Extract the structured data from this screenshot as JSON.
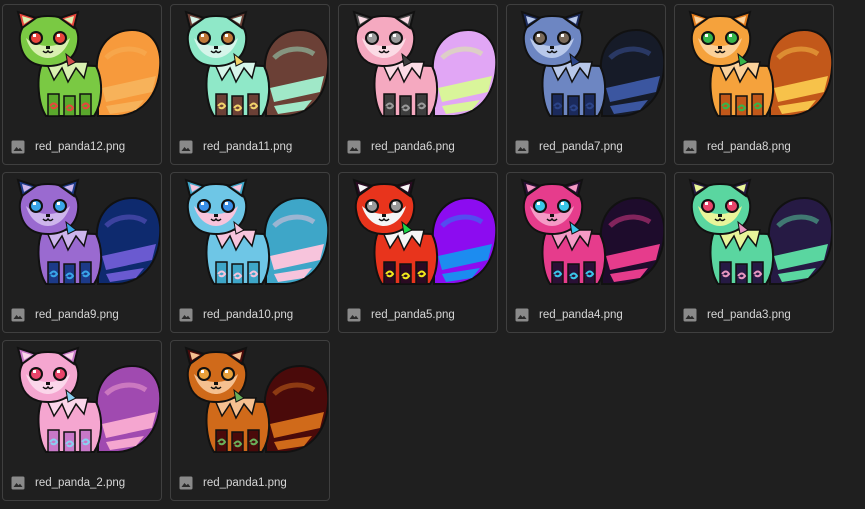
{
  "files": [
    {
      "name": "red_panda12.png",
      "body": "#7ac943",
      "fluff": "#d8f0b0",
      "tail": "#f79a3c",
      "tail2": "#f7b25a",
      "ear": "#e8453c",
      "eye": "#e8453c",
      "mark": "#e8453c",
      "legs": "#5aa82c",
      "accent": "#d04a4a"
    },
    {
      "name": "red_panda11.png",
      "body": "#8fe8c8",
      "fluff": "#d6f5ea",
      "tail": "#6b4036",
      "tail2": "#a0e8c8",
      "ear": "#6b4036",
      "eye": "#c07a3a",
      "mark": "#f2d36b",
      "legs": "#6b4036",
      "accent": "#f2d36b"
    },
    {
      "name": "red_panda6.png",
      "body": "#f5a9c0",
      "fluff": "#fbdbe5",
      "tail": "#e1a6f5",
      "tail2": "#d9f59a",
      "ear": "#4a4a4a",
      "eye": "#9a9a9a",
      "mark": "#9a9a9a",
      "legs": "#3d3d3d",
      "accent": "#3d3d3d"
    },
    {
      "name": "red_panda7.png",
      "body": "#6d86c2",
      "fluff": "#b8c8ea",
      "tail": "#161b28",
      "tail2": "#3b56a0",
      "ear": "#1b2a5c",
      "eye": "#7a6a5a",
      "mark": "#2b4488",
      "legs": "#1b2a5c",
      "accent": "#2b4488"
    },
    {
      "name": "red_panda8.png",
      "body": "#f5a23c",
      "fluff": "#fbd19a",
      "tail": "#c2581a",
      "tail2": "#f7c24a",
      "ear": "#e27a1a",
      "eye": "#35b54a",
      "mark": "#35b54a",
      "legs": "#c2581a",
      "accent": "#35b54a"
    },
    {
      "name": "red_panda9.png",
      "body": "#9a6ad0",
      "fluff": "#cdb5ec",
      "tail": "#0e2a6e",
      "tail2": "#6a5ad0",
      "ear": "#1c3a88",
      "eye": "#3aa6e8",
      "mark": "#3aa6e8",
      "legs": "#1c3a88",
      "accent": "#3aa6e8"
    },
    {
      "name": "red_panda10.png",
      "body": "#6ec6e6",
      "fluff": "#f7c4dc",
      "tail": "#3ea6c8",
      "tail2": "#f7c4dc",
      "ear": "#3ea6c8",
      "eye": "#3a8fe8",
      "mark": "#f7c4dc",
      "legs": "#3ea6c8",
      "accent": "#f7c4dc"
    },
    {
      "name": "red_panda5.png",
      "body": "#e8341c",
      "fluff": "#f5f5f5",
      "tail": "#8c0cf0",
      "tail2": "#1c8cf0",
      "ear": "#2a0a22",
      "eye": "#9a9a9a",
      "mark": "#f0e81c",
      "legs": "#2a0a22",
      "accent": "#1cd84a"
    },
    {
      "name": "red_panda4.png",
      "body": "#e63c8c",
      "fluff": "#f59ac6",
      "tail": "#1e0c2c",
      "tail2": "#e63c8c",
      "ear": "#2a1036",
      "eye": "#3ac6e8",
      "mark": "#3ac6e8",
      "legs": "#2a1036",
      "accent": "#3ac6e8"
    },
    {
      "name": "red_panda3.png",
      "body": "#5ad6a0",
      "fluff": "#e8f59a",
      "tail": "#261a44",
      "tail2": "#5ad6a0",
      "ear": "#261a44",
      "eye": "#e8456a",
      "mark": "#e896c0",
      "legs": "#261a44",
      "accent": "#e896c0"
    },
    {
      "name": "red_panda_2.png",
      "body": "#f5a6d0",
      "fluff": "#fbd6ea",
      "tail": "#a04ab0",
      "tail2": "#f5a6d0",
      "ear": "#c878c8",
      "eye": "#e8456a",
      "mark": "#8ad0f0",
      "legs": "#c878c8",
      "accent": "#8ad0f0"
    },
    {
      "name": "red_panda1.png",
      "body": "#d06a1a",
      "fluff": "#f5c090",
      "tail": "#4a0a0a",
      "tail2": "#d06a1a",
      "ear": "#4a0a0a",
      "eye": "#e8a03a",
      "mark": "#6ab05a",
      "legs": "#4a0a0a",
      "accent": "#6ab05a"
    }
  ]
}
